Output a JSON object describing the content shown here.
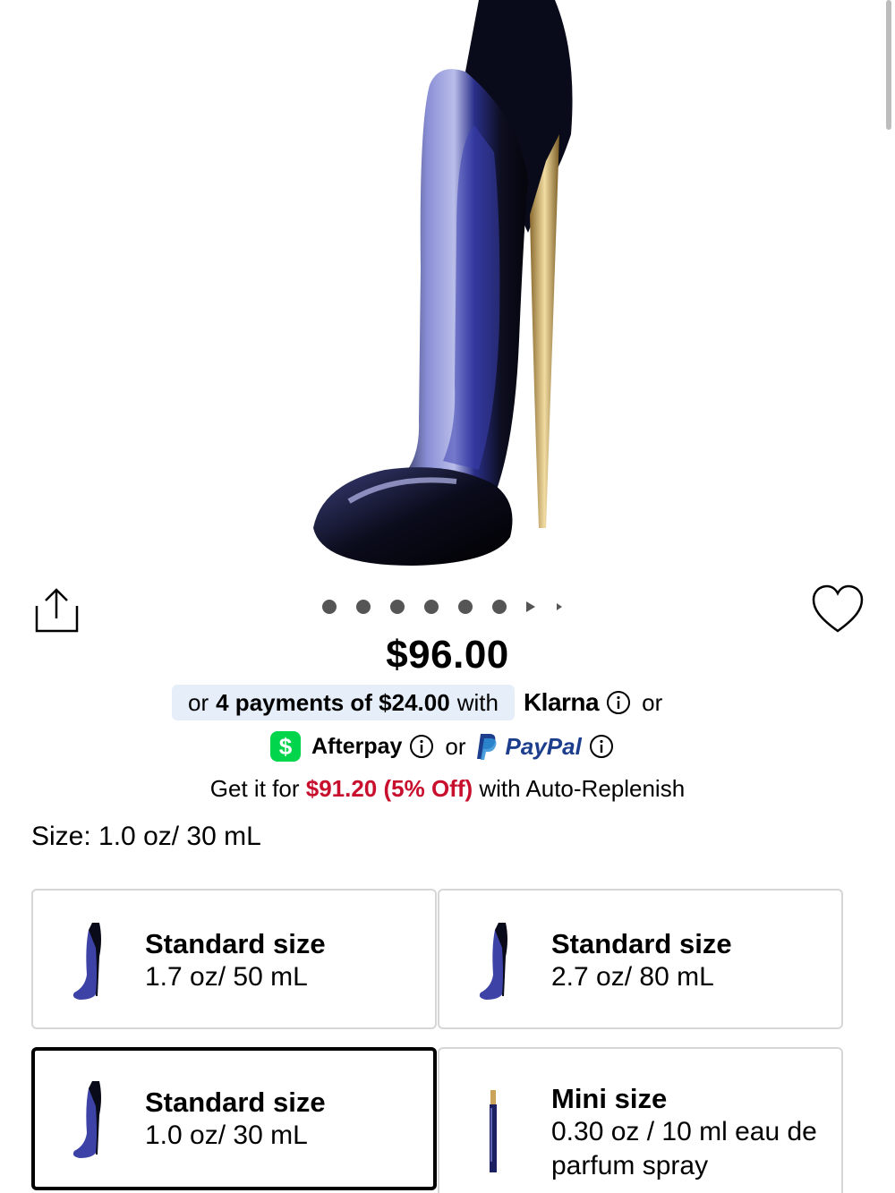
{
  "product": {
    "price": "$96.00"
  },
  "carousel": {
    "dot_count": 6
  },
  "payments": {
    "klarna": {
      "prefix": "or",
      "amount_text": "4 payments of $24.00",
      "suffix": "with",
      "brand": "Klarna",
      "trailing": "or"
    },
    "afterpay": {
      "symbol": "$",
      "brand": "Afterpay",
      "trailing": "or"
    },
    "paypal": {
      "brand": "PayPal"
    }
  },
  "auto_replenish": {
    "prefix": "Get it for",
    "offer": "$91.20 (5% Off)",
    "suffix": "with Auto-Replenish"
  },
  "size": {
    "label": "Size: 1.0 oz/ 30 mL",
    "options": [
      {
        "title": "Standard size",
        "detail": "1.7 oz/ 50 mL",
        "selected": false
      },
      {
        "title": "Standard size",
        "detail": "2.7 oz/ 80 mL",
        "selected": false
      },
      {
        "title": "Standard size",
        "detail": "1.0 oz/ 30 mL",
        "selected": true
      },
      {
        "title": "Mini size",
        "detail": "0.30 oz / 10 ml eau de parfum spray",
        "selected": false
      }
    ]
  },
  "colors": {
    "accent_red": "#c8102e",
    "klarna_bg": "#e6eef9",
    "afterpay_green": "#00d54b",
    "paypal_blue": "#1d3e8c"
  }
}
